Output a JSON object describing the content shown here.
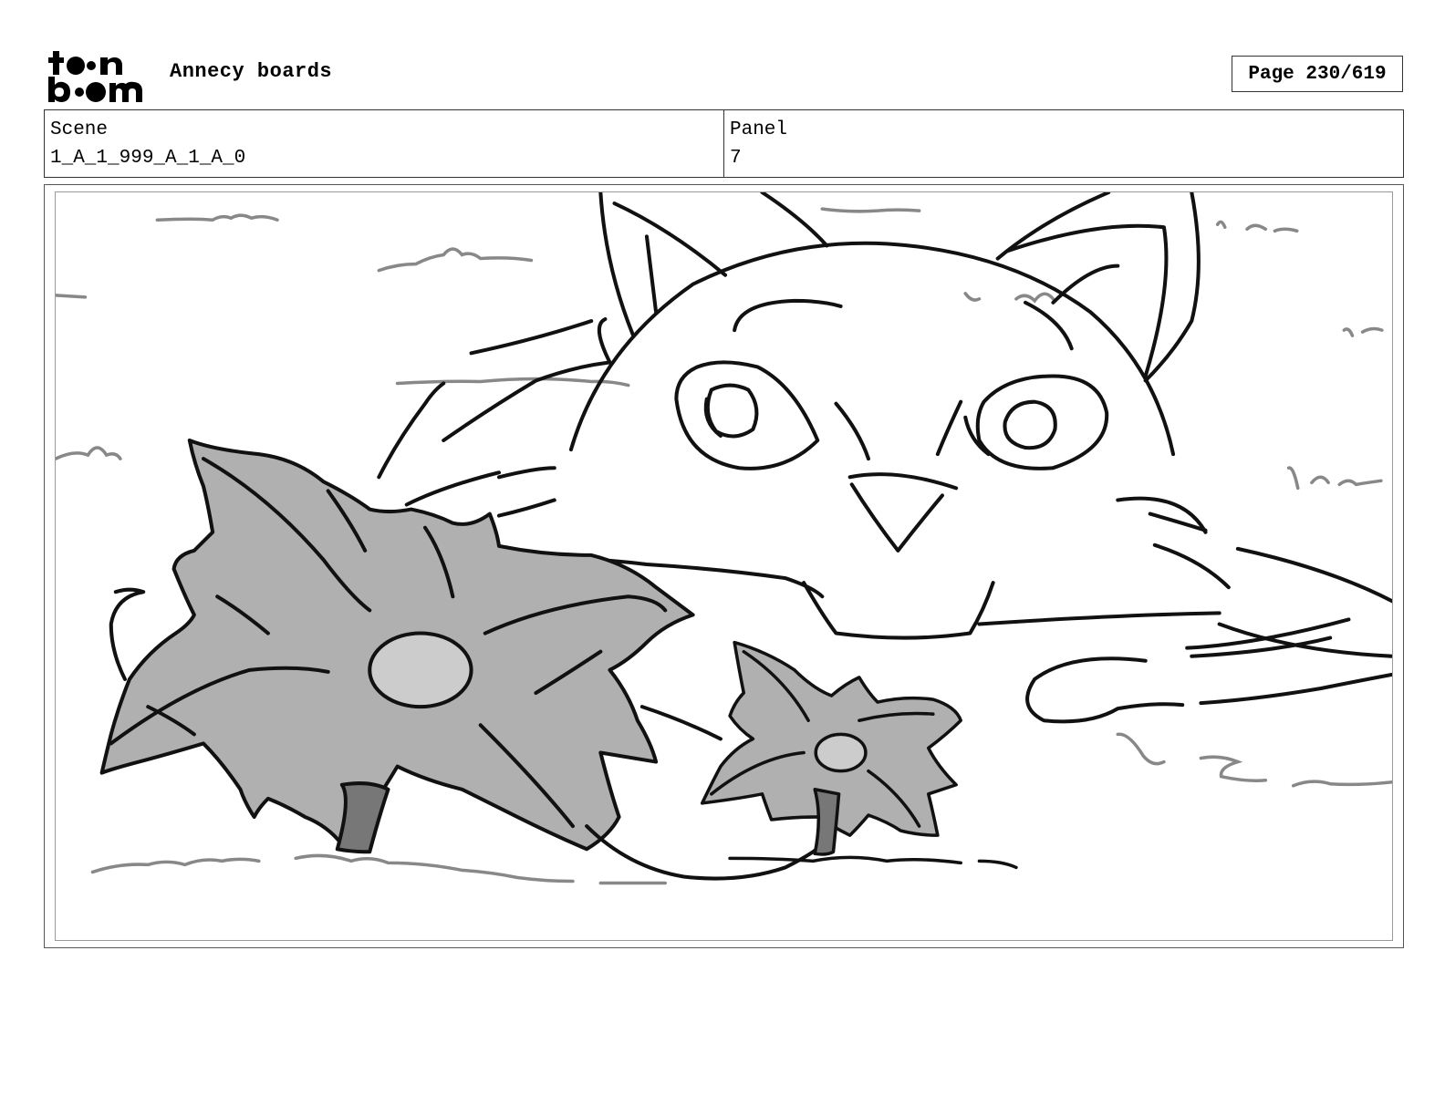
{
  "header": {
    "logo_text": "toon boom",
    "project_title": "Annecy boards",
    "page_label": "Page 230/619"
  },
  "info": {
    "scene_label": "Scene",
    "scene_value": "1_A_1_999_A_1_A_0",
    "panel_label": "Panel",
    "panel_value": "7"
  },
  "artwork": {
    "subject_icons": [
      "cat-head-sketch",
      "large-flower-sketch",
      "small-flower-sketch"
    ],
    "colors": {
      "line": "#111111",
      "flower_fill": "#b0b0b0",
      "center_fill": "#cccccc",
      "grass": "#888888"
    }
  }
}
